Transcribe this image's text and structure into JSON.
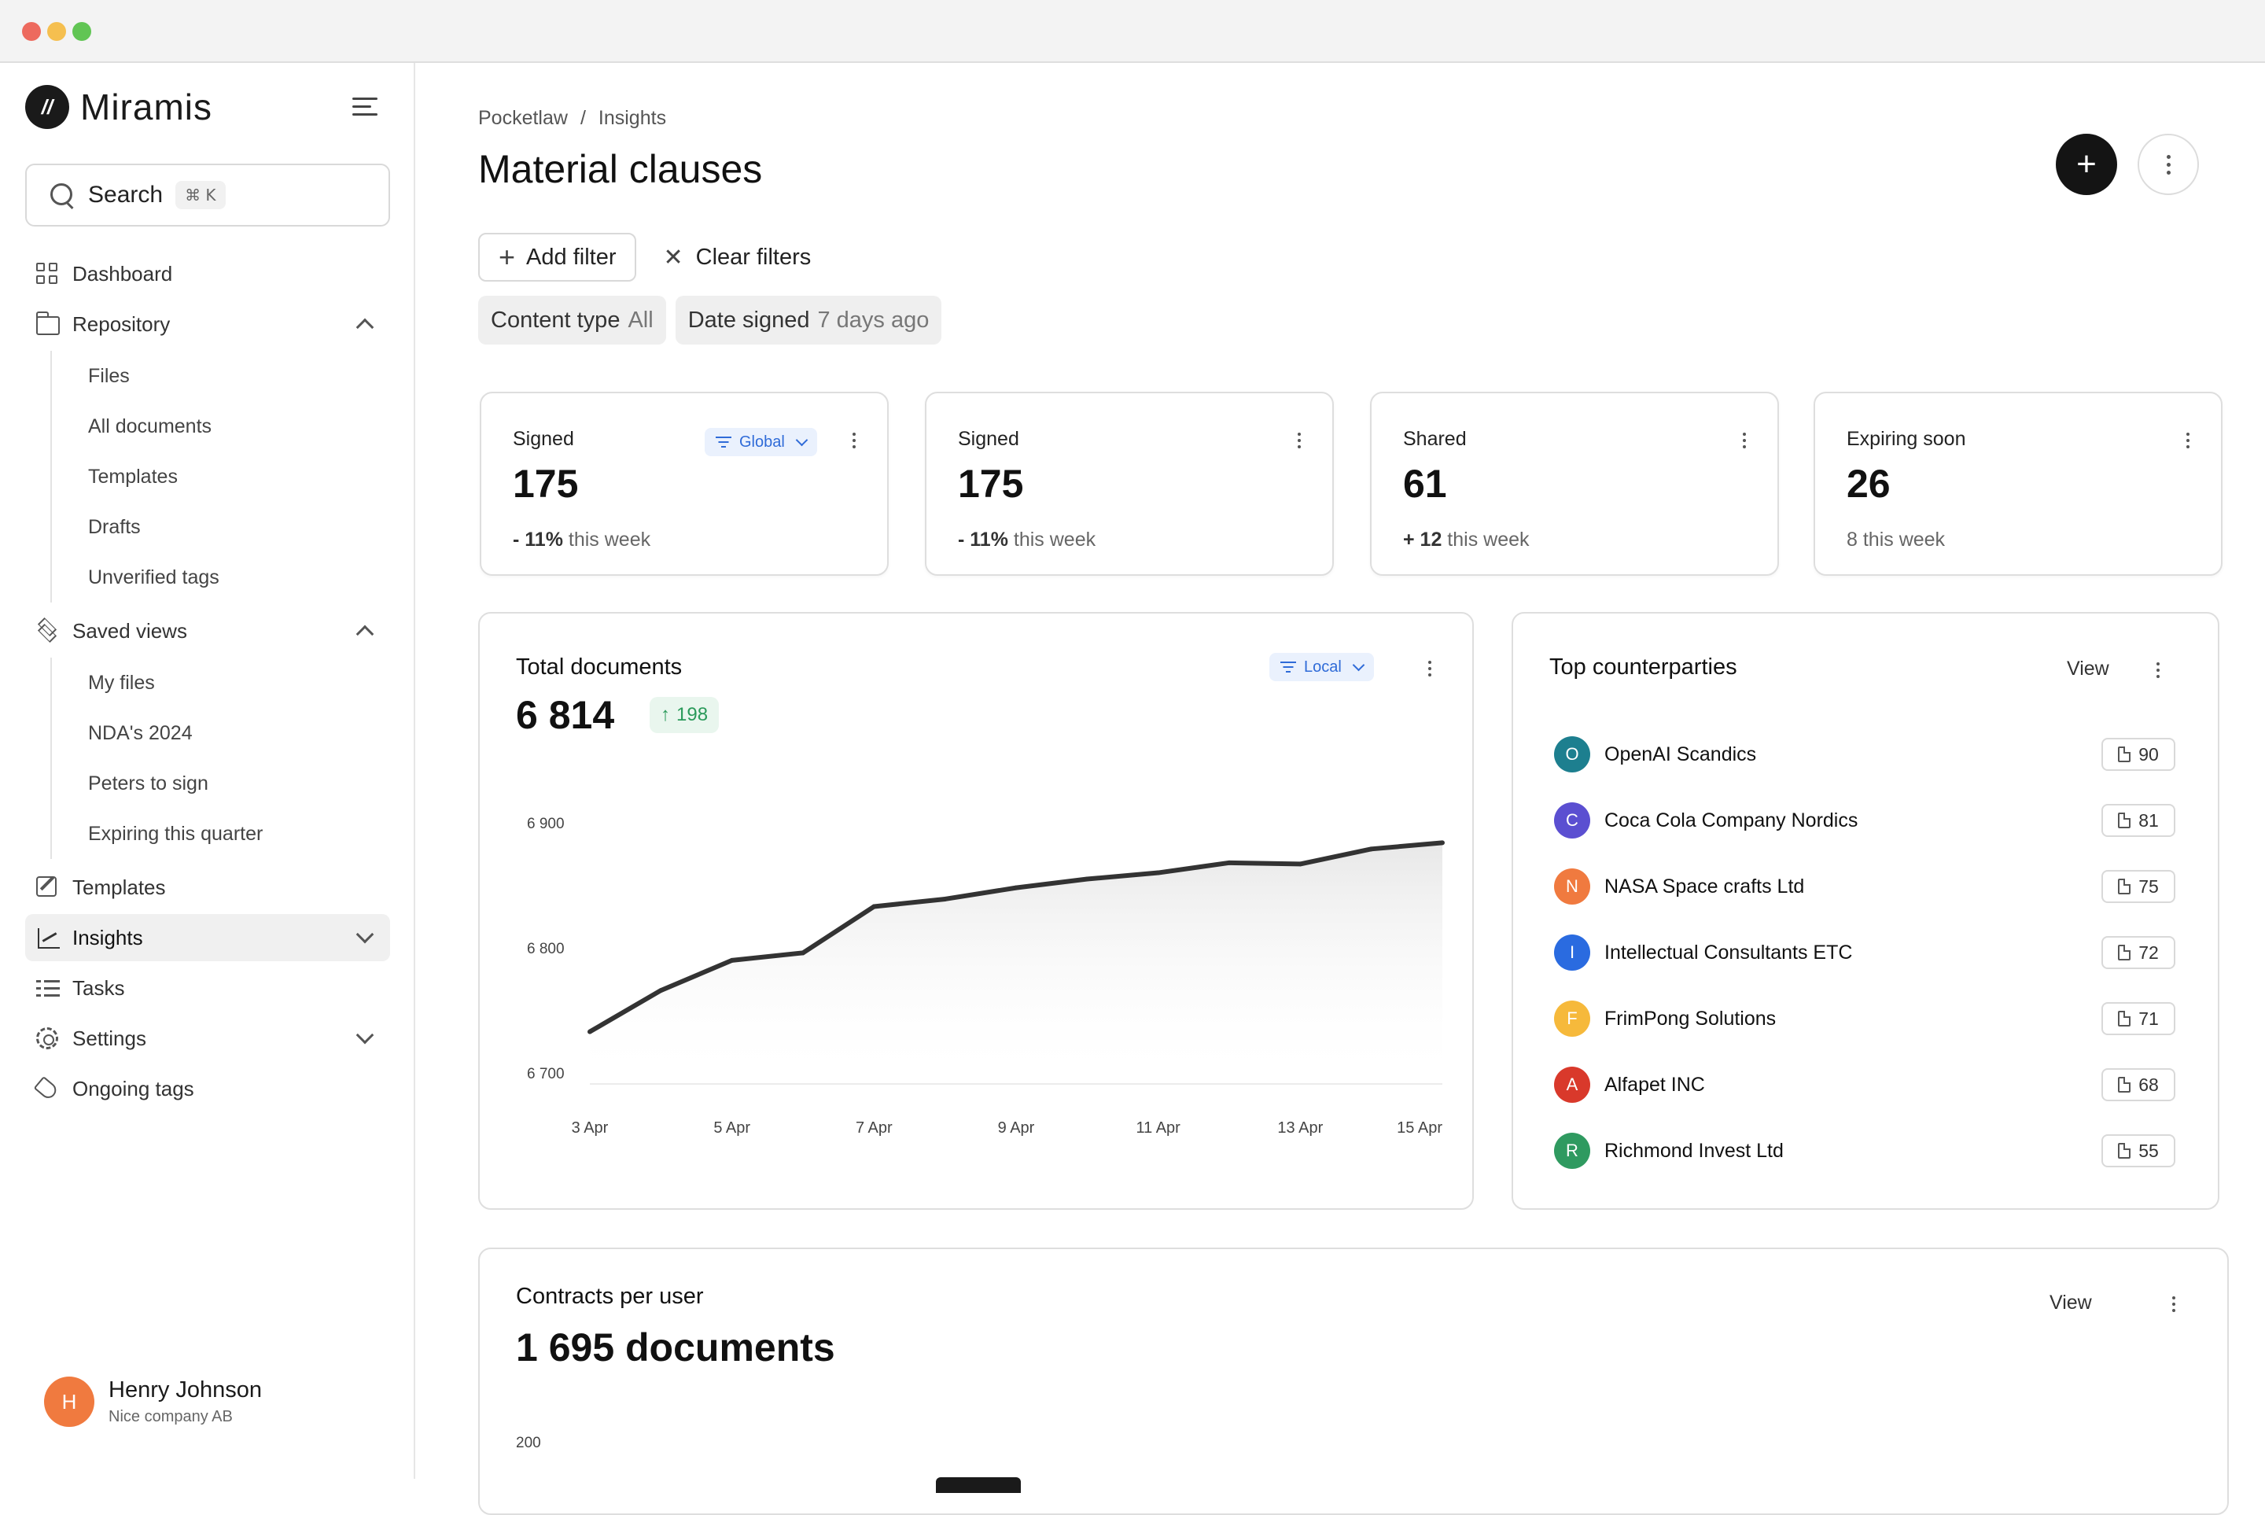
{
  "sidebar": {
    "brand": "Miramis",
    "search": {
      "label": "Search",
      "shortcut": "⌘ K"
    },
    "nav": {
      "dashboard": "Dashboard",
      "repository": "Repository",
      "repository_items": [
        "Files",
        "All documents",
        "Templates",
        "Drafts",
        "Unverified tags"
      ],
      "saved_views": "Saved views",
      "saved_views_items": [
        "My files",
        "NDA's 2024",
        "Peters to sign",
        "Expiring this quarter"
      ],
      "templates": "Templates",
      "insights": "Insights",
      "tasks": "Tasks",
      "settings": "Settings",
      "ongoing_tags": "Ongoing tags"
    },
    "active_item": "Insights",
    "user": {
      "initial": "H",
      "name": "Henry Johnson",
      "company": "Nice company AB"
    }
  },
  "header": {
    "breadcrumb": [
      "Pocketlaw",
      "/",
      "Insights"
    ],
    "title": "Material clauses"
  },
  "filters": {
    "add_filter": "Add filter",
    "clear_filters": "Clear filters",
    "chips": [
      {
        "label": "Content type",
        "value": "All"
      },
      {
        "label": "Date signed",
        "value": "7 days ago"
      }
    ]
  },
  "stats": [
    {
      "label": "Signed",
      "value": "175",
      "change_strong": "- 11%",
      "change_rest": " this week",
      "scope": "Global"
    },
    {
      "label": "Signed",
      "value": "175",
      "change_strong": "- 11%",
      "change_rest": " this week"
    },
    {
      "label": "Shared",
      "value": "61",
      "change_strong": "+ 12",
      "change_rest": " this week"
    },
    {
      "label": "Expiring soon",
      "value": "26",
      "change_strong": "",
      "change_rest": "8 this week"
    }
  ],
  "total_documents": {
    "title": "Total documents",
    "value": "6 814",
    "delta": "198",
    "scope": "Local"
  },
  "chart_data": {
    "type": "area",
    "title": "Total documents",
    "x": [
      "3 Apr",
      "4 Apr",
      "5 Apr",
      "6 Apr",
      "7 Apr",
      "8 Apr",
      "9 Apr",
      "10 Apr",
      "11 Apr",
      "12 Apr",
      "13 Apr",
      "14 Apr",
      "15 Apr"
    ],
    "y": [
      6733,
      6766,
      6790,
      6796,
      6833,
      6839,
      6848,
      6855,
      6860,
      6868,
      6867,
      6879,
      6884
    ],
    "y_ticks": [
      "6 700",
      "6 800",
      "6 900"
    ],
    "x_ticks": [
      "3 Apr",
      "5 Apr",
      "7 Apr",
      "9 Apr",
      "11 Apr",
      "13 Apr",
      "15 Apr"
    ],
    "ylim": [
      6690,
      6910
    ],
    "grid": false,
    "line_color": "#333333"
  },
  "counterparties": {
    "title": "Top counterparties",
    "view_label": "View",
    "items": [
      {
        "initial": "O",
        "name": "OpenAI Scandics",
        "count": "90",
        "color": "#1d7f8f"
      },
      {
        "initial": "C",
        "name": "Coca Cola Company Nordics",
        "count": "81",
        "color": "#5b4fd1"
      },
      {
        "initial": "N",
        "name": "NASA Space crafts Ltd",
        "count": "75",
        "color": "#f07a3f"
      },
      {
        "initial": "I",
        "name": "Intellectual Consultants ETC",
        "count": "72",
        "color": "#2a6be0"
      },
      {
        "initial": "F",
        "name": "FrimPong Solutions",
        "count": "71",
        "color": "#f6b93b"
      },
      {
        "initial": "A",
        "name": "Alfapet INC",
        "count": "68",
        "color": "#d9392b"
      },
      {
        "initial": "R",
        "name": "Richmond Invest Ltd",
        "count": "55",
        "color": "#2f9a60"
      }
    ]
  },
  "contracts_per_user": {
    "title": "Contracts per user",
    "value": "1 695 documents",
    "view_label": "View",
    "y_tick": "200"
  }
}
